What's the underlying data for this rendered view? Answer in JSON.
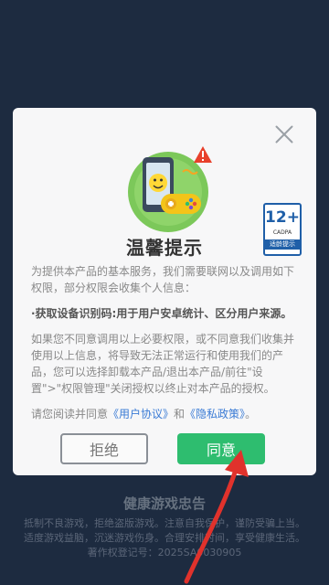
{
  "background": {
    "title": "健康游戏忠告",
    "lines": [
      "抵制不良游戏，拒绝盗版游戏。注意自我保护，谨防受骗上当。",
      "适度游戏益脑，沉迷游戏伤身。合理安排时间，享受健康生活。",
      "著作权登记号：2025SA0030905"
    ]
  },
  "dialog": {
    "title": "温馨提示",
    "age_rating": {
      "number": "12+",
      "org": "CADPA",
      "tag": "适龄提示"
    },
    "paragraphs": [
      "为提供本产品的基本服务，我们需要联网以及调用如下权限，部分权限会收集个人信息：",
      "·获取设备识别码:用于用户安卓统计、区分用户来源。",
      "如果您不同意调用以上必要权限，或不同意我们收集并使用以上信息，将导致无法正常运行和使用我们的产品，您可以选择卸载本产品/退出本产品/前往\"设置\">\"权限管理\"关闭授权以终止对本产品的授权。"
    ],
    "agreement": {
      "prefix": "请您阅读并同意",
      "user_agreement": "《用户协议》",
      "connector": "和",
      "privacy_policy": "《隐私政策》",
      "suffix": "。"
    },
    "reject_label": "拒绝",
    "agree_label": "同意"
  },
  "colors": {
    "background": "#1d2b40",
    "dialog": "#f7f7f8",
    "agree_button": "#2ebd6f",
    "link": "#3a7bd5",
    "arrow": "#e0322c"
  }
}
